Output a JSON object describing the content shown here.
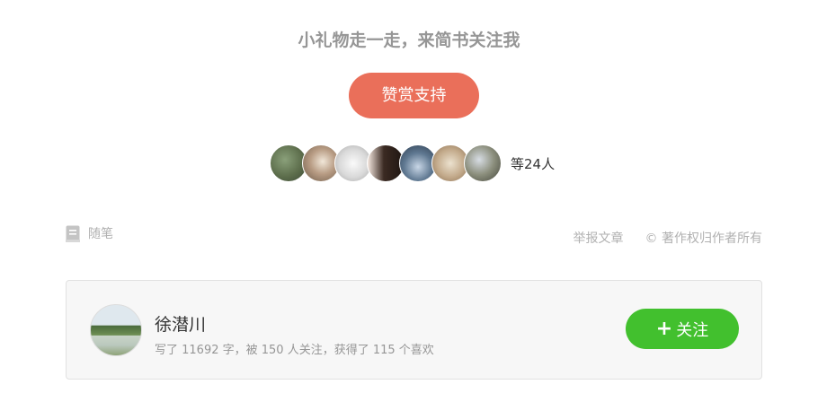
{
  "reward": {
    "title": "小礼物走一走，来简书关注我",
    "button_label": "赞赏支持",
    "supporters_count": "等24人"
  },
  "supporter_avatars": 7,
  "article_meta": {
    "notebook_label": "随笔",
    "notebook_icon": "notebook-icon",
    "report_label": "举报文章",
    "copyright_label": "© 著作权归作者所有"
  },
  "author": {
    "name": "徐潜川",
    "stats": "写了 11692 字，被 150 人关注，获得了 115 个喜欢",
    "follow_label": "关注",
    "follow_icon": "plus-icon"
  },
  "colors": {
    "reward_button": "#ea6f5a",
    "follow_button": "#42c02e",
    "muted_text": "#969696"
  }
}
